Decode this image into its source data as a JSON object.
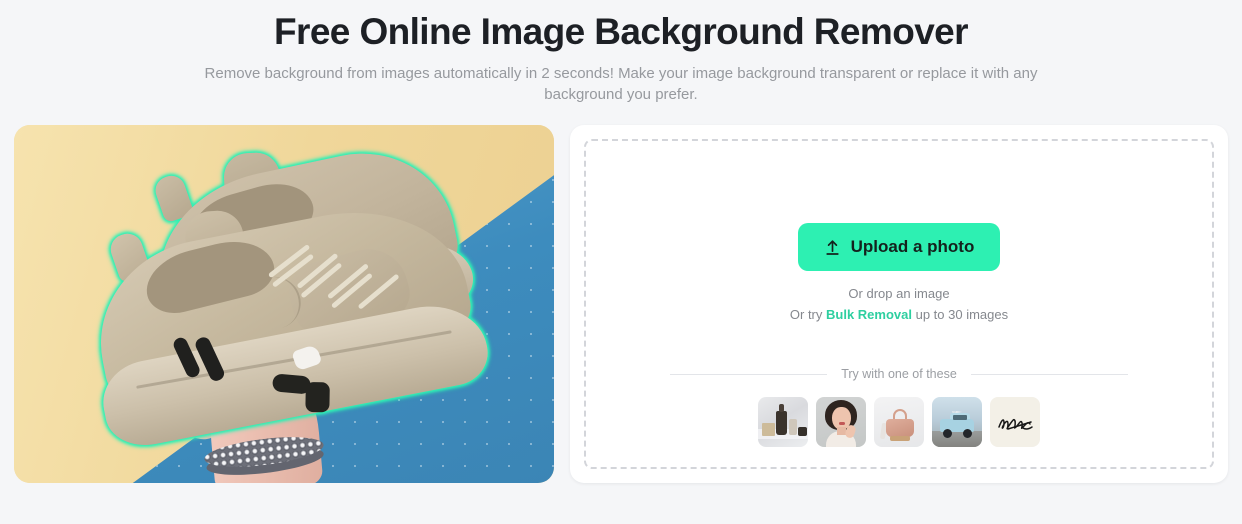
{
  "header": {
    "title": "Free Online Image Background Remover",
    "subtitle": "Remove background from images automatically in 2 seconds! Make your image background transparent or replace it with any background you prefer."
  },
  "preview": {
    "alt": "Beige sneakers held in a hand with green cut-out outline",
    "background_yellow": "#f0d79a",
    "background_blue": "#3d8cbe",
    "outline_color": "#2ff0b4"
  },
  "uploader": {
    "upload_label": "Upload a photo",
    "upload_icon": "upload-arrow-icon",
    "drop_hint": "Or drop an image",
    "bulk_prefix": "Or try ",
    "bulk_link": "Bulk Removal",
    "bulk_suffix": " up to 30 images",
    "samples_label": "Try with one of these",
    "button_color": "#2df0b2",
    "link_color": "#2ecfa0",
    "samples": [
      {
        "name": "cosmetics",
        "alt": "Cosmetic bottles on marble"
      },
      {
        "name": "portrait",
        "alt": "Portrait of a woman with curly hair"
      },
      {
        "name": "handbag",
        "alt": "Pink leather handbag"
      },
      {
        "name": "car",
        "alt": "Light blue SUV in mountains"
      },
      {
        "name": "signature",
        "alt": "Handwritten signature on paper"
      }
    ]
  }
}
